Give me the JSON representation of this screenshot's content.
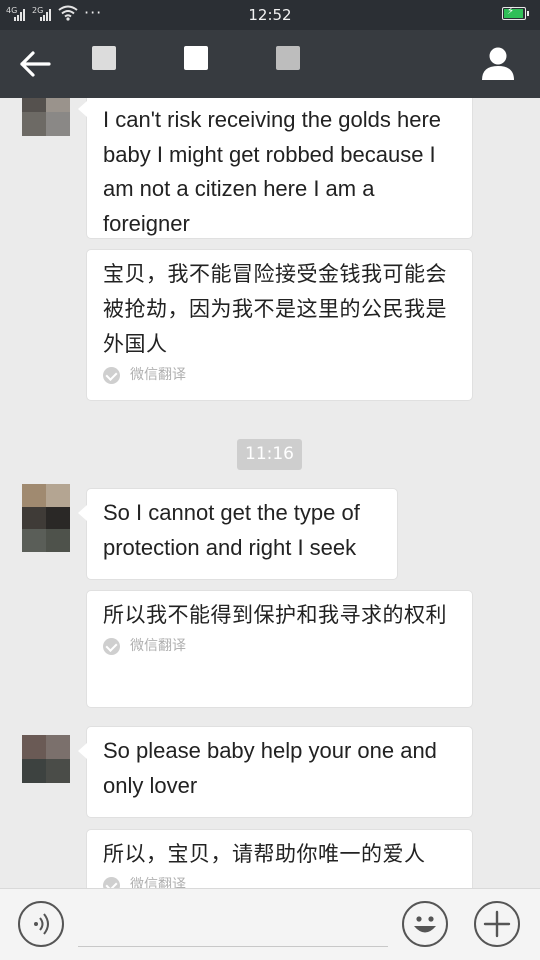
{
  "status_bar": {
    "network_1": "4G",
    "network_2": "2G",
    "more": "···",
    "time": "12:52"
  },
  "title_bar": {
    "back_icon": "arrow-left-icon",
    "profile_icon": "person-icon"
  },
  "messages": [
    {
      "text": "I can't risk receiving the golds here baby I might get robbed because I am not a citizen here I am a foreigner",
      "translation": "宝贝，我不能冒险接受金钱我可能会被抢劫，因为我不是这里的公民我是外国人",
      "translation_tag": "微信翻译"
    },
    {
      "text": "So I cannot get the type of protection and right I seek",
      "translation": "所以我不能得到保护和我寻求的权利",
      "translation_tag": "微信翻译"
    },
    {
      "text": "So please baby help your one and only lover",
      "translation": "所以，宝贝，请帮助你唯一的爱人",
      "translation_tag": "微信翻译"
    }
  ],
  "timestamp": "11:16",
  "colors": {
    "title_bar": "#373b40",
    "status_bar": "#2b2f34",
    "chat_bg": "#ebebeb",
    "bubble": "#ffffff",
    "battery": "#2fbf57"
  },
  "bottom_bar": {
    "voice_icon": "voice-icon",
    "emoji_icon": "emoji-icon",
    "add_icon": "plus-icon"
  }
}
